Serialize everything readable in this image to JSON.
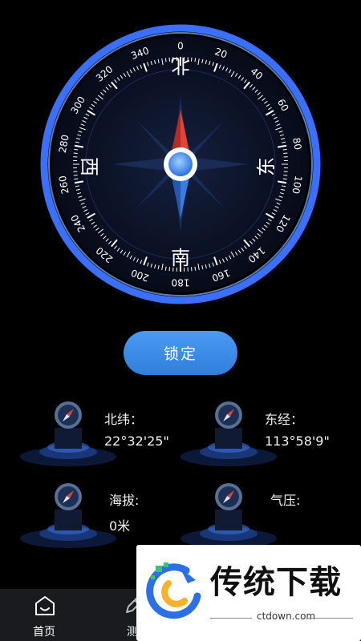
{
  "compass": {
    "degree_labels": [
      "0",
      "20",
      "40",
      "60",
      "80",
      "100",
      "120",
      "140",
      "160",
      "180",
      "200",
      "220",
      "240",
      "260",
      "280",
      "300",
      "320",
      "340"
    ],
    "cardinals": {
      "north": "北",
      "east": "东",
      "south": "南",
      "west": "西"
    },
    "colors": {
      "ring": "#3a7bff",
      "dial": "#0c1226",
      "needle_north": "#e0443a",
      "needle_south": "#2f6fd6"
    }
  },
  "lock_button": {
    "label": "锁定"
  },
  "stats": {
    "latitude": {
      "label": "北纬：",
      "value": "22°32'25\""
    },
    "longitude": {
      "label": "东经：",
      "value": "113°58'9\""
    },
    "altitude": {
      "label": "海拔:",
      "value": "0米"
    },
    "pressure": {
      "label": "气压:",
      "value": ""
    }
  },
  "nav": {
    "home": {
      "label": "首页",
      "icon": "home-icon"
    },
    "measure": {
      "label": "测",
      "icon": "pencil-icon"
    }
  },
  "watermark": {
    "brand": "传统下载",
    "domain": "ctdown.com"
  }
}
